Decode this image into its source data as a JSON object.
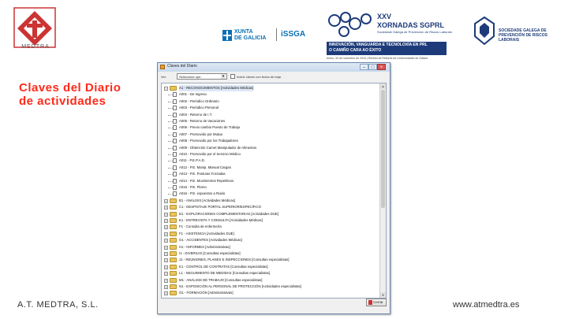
{
  "header": {
    "medtra_name": "MEDTRA",
    "xunta_line1": "XUNTA",
    "xunta_line2": "DE GALICIA",
    "issga": "iSSGA",
    "jornadas_line1": "XXV",
    "jornadas_line2": "XORNADAS SGPRL",
    "jornadas_sub": "Sociedade Galega de Prevención de Riscos Laborais",
    "jornadas_banner_line1": "INNOVACIÓN, VANGUARDA E TECNOLOXÍA EN PRL",
    "jornadas_banner_line2": "O CAMIÑO CARA AO ÉXITO",
    "jornadas_date": "Ames, 30 de novembro de 2018 | Recinto de Reitores de Universidades de Galicia",
    "sgprl_text": "SOCIEDADE GALEGA DE PREVENCIÓN DE RISCOS LABORAIS"
  },
  "slide": {
    "title_line1": "Claves del Diario",
    "title_line2": "de actividades"
  },
  "footer": {
    "left": "A.T. MEDTRA, S.L.",
    "right": "www.atmedtra.es"
  },
  "dialog": {
    "title": "Claves del Diario",
    "toolbar_label": "Ver:",
    "select_value": "Seleccione ope..",
    "checkbox_label": "Incluir claves con fecha de baja",
    "close_label": "Cerrar",
    "tree": [
      {
        "level": 0,
        "expanded": true,
        "text": "A1 - RECONOCIMIENTOS [Actividades Médicas]",
        "selected": true
      },
      {
        "level": 1,
        "text": "A001 - De Ingreso"
      },
      {
        "level": 1,
        "text": "A002 - Periódico Ordinario"
      },
      {
        "level": 1,
        "text": "A003 - Periódico Personal"
      },
      {
        "level": 1,
        "text": "A004 - Retorno de I.T."
      },
      {
        "level": 1,
        "text": "A005 - Retorno de Vacaciones"
      },
      {
        "level": 1,
        "text": "A006 - Previo cambio Puesto de Trabajo"
      },
      {
        "level": 1,
        "text": "A007 - Promovido por Mutua"
      },
      {
        "level": 1,
        "text": "A008 - Promovido por los Trabajadores"
      },
      {
        "level": 1,
        "text": "A009 - Obtención Carnet Manipulador de Alimentos"
      },
      {
        "level": 1,
        "text": "A010 - Promovido por el Servicio Médico"
      },
      {
        "level": 1,
        "text": "A011 - P.E.P.A.D."
      },
      {
        "level": 1,
        "text": "A012 - P.E. Manip. Manual Cargas"
      },
      {
        "level": 1,
        "text": "A013 - P.E. Posturas Forzadas"
      },
      {
        "level": 1,
        "text": "A014 - P.E. Movimientos Repetitivos"
      },
      {
        "level": 1,
        "text": "A015 - P.E. Plomo"
      },
      {
        "level": 1,
        "text": "A016 - P.E. expuestos a Ruido"
      },
      {
        "level": 0,
        "text": "B1 - ANÁLISIS [Actividades Médicas]"
      },
      {
        "level": 0,
        "text": "C1 - DESPISTAJE PORTAL SUPERIOR/ESPECÍFICO"
      },
      {
        "level": 0,
        "text": "D1 - EXPLORACIONES COMPLEMENTARIAS [Actividades DUE]"
      },
      {
        "level": 0,
        "text": "E1 - ENTREVISTA Y CONSULTA [Actividades Médicas]"
      },
      {
        "level": 0,
        "text": "F1 - Consulta de enfermería"
      },
      {
        "level": 0,
        "text": "F1 - ASISTENCIA [Actividades DUE]"
      },
      {
        "level": 0,
        "text": "G1 - ACCIDENTES [Actividades Médicas]"
      },
      {
        "level": 0,
        "text": "H1 - INFORMES [Administrativas]"
      },
      {
        "level": 0,
        "text": "I1 - DIVERSAS [Consultas especialistas]"
      },
      {
        "level": 0,
        "text": "J1 - REUNIONES, PLANES E INSPECCIONES [Consultas especialistas]"
      },
      {
        "level": 0,
        "text": "K1 - CONTROL DE CONTRATAS [Consultas especialistas]"
      },
      {
        "level": 0,
        "text": "L1 - SEGUIMIENTO DE MEDIDAS [Consultas especialistas]"
      },
      {
        "level": 0,
        "text": "M1 - ANÁLISIS DE TRABAJO [Consultas especialistas]"
      },
      {
        "level": 0,
        "text": "N1 - EXPOSICIÓN AL PERSONAL DE PROTECCIÓN [Actividades especialistas]"
      },
      {
        "level": 0,
        "text": "O1 - FORMACIÓN [Administrativas]"
      }
    ]
  },
  "colors": {
    "title_red": "#ff2a1a",
    "brand_blue": "#1d3b7a",
    "xunta_blue": "#0a6fb5"
  }
}
